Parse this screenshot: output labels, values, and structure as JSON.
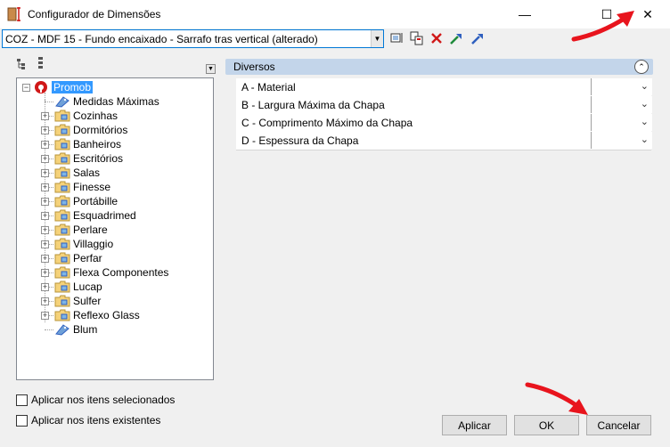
{
  "window": {
    "title": "Configurador de Dimensões",
    "minimize_glyph": "—",
    "maximize_glyph": "☐",
    "close_glyph": "✕"
  },
  "preset": {
    "value": "COZ - MDF 15 - Fundo encaixado - Sarrafo tras vertical (alterado)"
  },
  "toolbar": {
    "icons": [
      "select-dimension-icon",
      "copy-icon",
      "delete-icon",
      "import-icon",
      "export-icon"
    ]
  },
  "tree": {
    "root": {
      "label": "Promob",
      "expanded": true
    },
    "items": [
      {
        "label": "Medidas Máximas",
        "kind": "tag"
      },
      {
        "label": "Cozinhas",
        "kind": "folder"
      },
      {
        "label": "Dormitórios",
        "kind": "folder"
      },
      {
        "label": "Banheiros",
        "kind": "folder"
      },
      {
        "label": "Escritórios",
        "kind": "folder"
      },
      {
        "label": "Salas",
        "kind": "folder"
      },
      {
        "label": "Finesse",
        "kind": "folder"
      },
      {
        "label": "Portábille",
        "kind": "folder"
      },
      {
        "label": "Esquadrimed",
        "kind": "folder"
      },
      {
        "label": "Perlare",
        "kind": "folder"
      },
      {
        "label": "Villaggio",
        "kind": "folder"
      },
      {
        "label": "Perfar",
        "kind": "folder"
      },
      {
        "label": "Flexa Componentes",
        "kind": "folder"
      },
      {
        "label": "Lucap",
        "kind": "folder"
      },
      {
        "label": "Sulfer",
        "kind": "folder"
      },
      {
        "label": "Reflexo Glass",
        "kind": "folder"
      },
      {
        "label": "Blum",
        "kind": "tag"
      }
    ]
  },
  "options": {
    "apply_selected": "Aplicar nos itens selecionados",
    "apply_existing": "Aplicar nos itens existentes"
  },
  "properties": {
    "section_title": "Diversos",
    "rows": [
      {
        "label": "A - Material",
        "value": ""
      },
      {
        "label": "B - Largura Máxima da Chapa",
        "value": ""
      },
      {
        "label": "C - Comprimento Máximo da Chapa",
        "value": ""
      },
      {
        "label": "D - Espessura da Chapa",
        "value": ""
      }
    ]
  },
  "buttons": {
    "apply": "Aplicar",
    "ok": "OK",
    "cancel": "Cancelar"
  },
  "colors": {
    "selection": "#3399ff",
    "header_band": "#c3d5ea",
    "annotation_arrow": "#e8141d",
    "folder": "#f5d27a"
  }
}
